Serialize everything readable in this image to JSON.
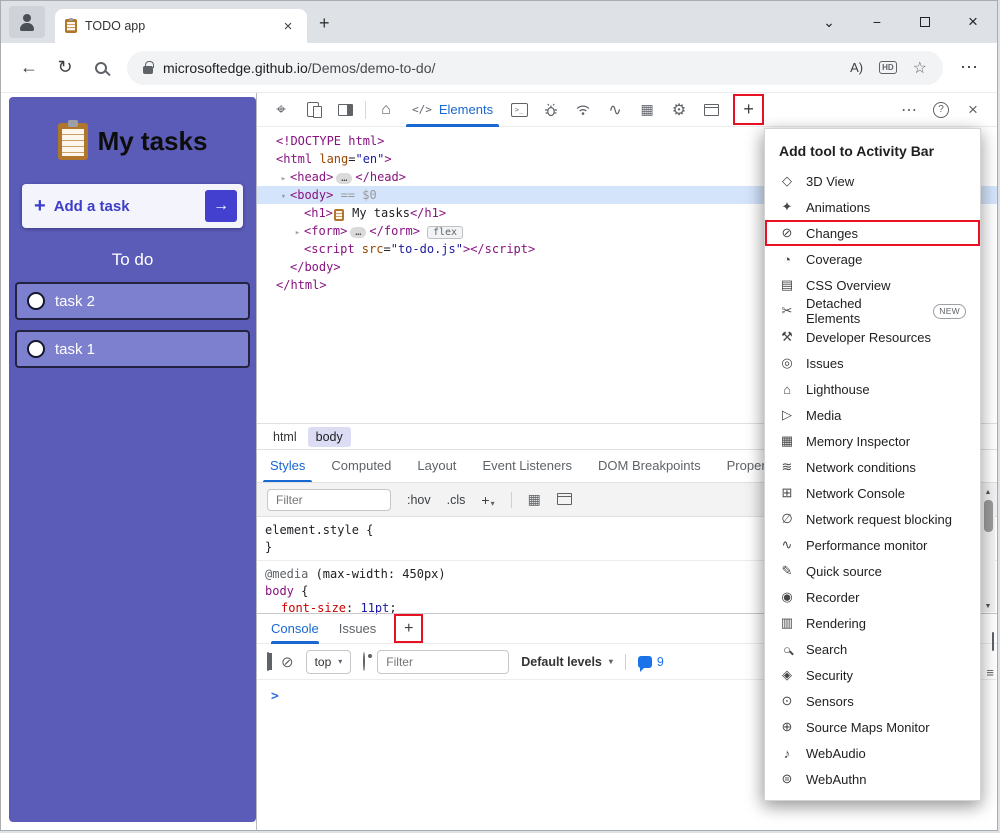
{
  "window": {
    "tab_title": "TODO app",
    "url_domain": "microsoftedge.github.io",
    "url_path": "/Demos/demo-to-do/"
  },
  "icons": {
    "plus": "+",
    "chevron": "⌄",
    "minimize": "−",
    "close": "×",
    "back": "←",
    "reload": "↻",
    "star": "☆",
    "more": "⋯",
    "read_aloud": "A)",
    "hd": "HD",
    "inspect": "⌖",
    "home": "⌂",
    "elements_code": "</>",
    "console_glyph": ">_",
    "performance": "∿",
    "memory": "▦",
    "gear": "⚙",
    "help": "?",
    "tri_right": "▸",
    "tri_down": "▾",
    "clear": "⊘",
    "prompt": ">",
    "up": "▲",
    "down": "▼",
    "hamburger": "≡"
  },
  "todo": {
    "title": "My tasks",
    "add_label": "Add a task",
    "arrow": "→",
    "section": "To do",
    "tasks": [
      "task 2",
      "task 1"
    ]
  },
  "devtools": {
    "elements_tab": "Elements",
    "code_lines": [
      {
        "indent": 0,
        "tokens": [
          {
            "c": "tag",
            "s": "<!DOCTYPE html>"
          }
        ]
      },
      {
        "indent": 0,
        "tokens": [
          {
            "c": "tag",
            "s": "<html"
          },
          {
            "c": "attr",
            "s": " lang"
          },
          {
            "c": "p",
            "s": "="
          },
          {
            "c": "val",
            "s": "\"en\""
          },
          {
            "c": "tag",
            "s": ">"
          }
        ]
      },
      {
        "indent": 1,
        "g": "r",
        "tokens": [
          {
            "c": "tag",
            "s": "<head>"
          },
          {
            "c": "dots",
            "s": "…"
          },
          {
            "c": "tag",
            "s": "</head>"
          }
        ]
      },
      {
        "indent": 1,
        "g": "d",
        "sel": true,
        "tokens": [
          {
            "c": "tag",
            "s": "<body>"
          },
          {
            "c": "meta",
            "s": " == $0"
          }
        ]
      },
      {
        "indent": 2,
        "tokens": [
          {
            "c": "tag",
            "s": "<h1>"
          },
          {
            "c": "clip",
            "s": ""
          },
          {
            "c": "txt",
            "s": " My tasks"
          },
          {
            "c": "tag",
            "s": "</h1>"
          }
        ]
      },
      {
        "indent": 2,
        "g": "r",
        "tokens": [
          {
            "c": "tag",
            "s": "<form>"
          },
          {
            "c": "dots",
            "s": "…"
          },
          {
            "c": "tag",
            "s": "</form>"
          },
          {
            "c": "badge",
            "s": "flex"
          }
        ]
      },
      {
        "indent": 2,
        "tokens": [
          {
            "c": "tag",
            "s": "<script"
          },
          {
            "c": "attr",
            "s": " src"
          },
          {
            "c": "p",
            "s": "="
          },
          {
            "c": "val",
            "s": "\"to-do.js\""
          },
          {
            "c": "tag",
            "s": ">"
          },
          {
            "c": "tag",
            "s": "</script>"
          }
        ]
      },
      {
        "indent": 1,
        "tokens": [
          {
            "c": "tag",
            "s": "</body>"
          }
        ]
      },
      {
        "indent": 0,
        "tokens": [
          {
            "c": "tag",
            "s": "</html>"
          }
        ]
      }
    ],
    "breadcrumb": [
      "html",
      "body"
    ],
    "style_tabs": [
      "Styles",
      "Computed",
      "Layout",
      "Event Listeners",
      "DOM Breakpoints",
      "Properties"
    ],
    "stylebar": {
      "filter_placeholder": "Filter",
      "hov": ":hov",
      "cls": ".cls"
    },
    "css": {
      "element_style": "element.style",
      "open_brace": "{",
      "close_brace": "}",
      "media_at": "@media",
      "media_query": " (max-width: 450px)",
      "body_selector": "body",
      "body_open": " {",
      "prop_name": "font-size",
      "prop_sep": ": ",
      "prop_value": "11pt",
      "semi": ";"
    },
    "drawer": {
      "tabs": [
        "Console",
        "Issues"
      ],
      "top_value": "top",
      "filter_placeholder": "Filter",
      "levels_label": "Default levels",
      "badge_count": "9"
    }
  },
  "menu": {
    "header": "Add tool to Activity Bar",
    "items": [
      {
        "label": "3D View",
        "glyph": "◇",
        "icon_name": "3d-view-icon"
      },
      {
        "label": "Animations",
        "glyph": "✦",
        "icon_name": "animations-icon"
      },
      {
        "label": "Changes",
        "glyph": "⊘",
        "icon_name": "changes-icon",
        "highlight": true
      },
      {
        "label": "Coverage",
        "glyph": "◔",
        "icon_name": "coverage-icon"
      },
      {
        "label": "CSS Overview",
        "glyph": "▤",
        "icon_name": "css-overview-icon"
      },
      {
        "label": "Detached Elements",
        "glyph": "✂",
        "icon_name": "detached-elements-icon",
        "badge": "NEW"
      },
      {
        "label": "Developer Resources",
        "glyph": "⚒",
        "icon_name": "developer-resources-icon"
      },
      {
        "label": "Issues",
        "glyph": "◎",
        "icon_name": "issues-icon"
      },
      {
        "label": "Lighthouse",
        "glyph": "⌂",
        "icon_name": "lighthouse-icon"
      },
      {
        "label": "Media",
        "glyph": "▷",
        "icon_name": "media-icon"
      },
      {
        "label": "Memory Inspector",
        "glyph": "▦",
        "icon_name": "memory-inspector-icon"
      },
      {
        "label": "Network conditions",
        "glyph": "≋",
        "icon_name": "network-conditions-icon"
      },
      {
        "label": "Network Console",
        "glyph": "⊞",
        "icon_name": "network-console-icon"
      },
      {
        "label": "Network request blocking",
        "glyph": "∅",
        "icon_name": "network-request-blocking-icon"
      },
      {
        "label": "Performance monitor",
        "glyph": "∿",
        "icon_name": "performance-monitor-icon"
      },
      {
        "label": "Quick source",
        "glyph": "✎",
        "icon_name": "quick-source-icon"
      },
      {
        "label": "Recorder",
        "glyph": "◉",
        "icon_name": "recorder-icon"
      },
      {
        "label": "Rendering",
        "glyph": "▥",
        "icon_name": "rendering-icon"
      },
      {
        "label": "Search",
        "glyph": "○",
        "icon_name": "search-icon"
      },
      {
        "label": "Security",
        "glyph": "◈",
        "icon_name": "security-icon"
      },
      {
        "label": "Sensors",
        "glyph": "⊙",
        "icon_name": "sensors-icon"
      },
      {
        "label": "Source Maps Monitor",
        "glyph": "⊕",
        "icon_name": "source-maps-monitor-icon"
      },
      {
        "label": "WebAudio",
        "glyph": "♪",
        "icon_name": "webaudio-icon"
      },
      {
        "label": "WebAuthn",
        "glyph": "⊜",
        "icon_name": "webauthn-icon"
      }
    ]
  },
  "colors": {
    "annotation_red": "#e81123",
    "todo_purple": "#5b5bb8",
    "task_purple": "#7d80cf",
    "selection_blue": "#d4e4fb",
    "devtools_accent_blue": "#1967d2"
  }
}
